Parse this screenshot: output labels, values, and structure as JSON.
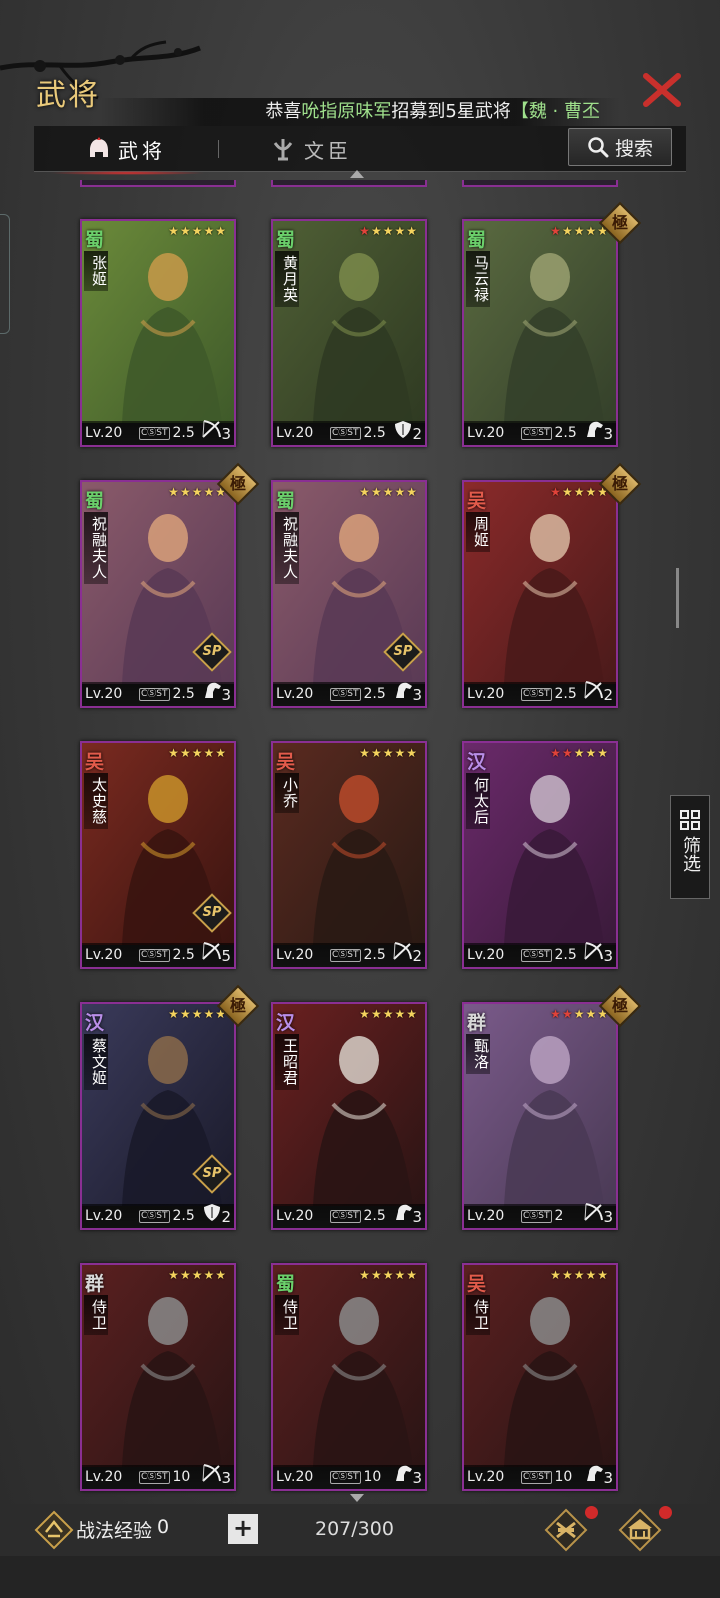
{
  "header": {
    "title": "武将",
    "notice": {
      "prefix": "恭喜",
      "player": "吮指原味军",
      "middle": "招募到5星武将",
      "bracket": "【",
      "general": "魏 · 曹丕"
    }
  },
  "tabs": [
    {
      "label": "武将",
      "active": true,
      "icon": "helmet-icon"
    },
    {
      "label": "文臣",
      "active": false,
      "icon": "scholar-icon"
    }
  ],
  "search": {
    "label": "搜索",
    "icon": "search-icon"
  },
  "filter": {
    "label": "筛选",
    "icon": "grid-icon"
  },
  "cards": [
    {
      "faction": "蜀",
      "name": "张姬",
      "stars": 5,
      "red_stars": 0,
      "ji": false,
      "sp": false,
      "level": "Lv.20",
      "cost": "2.5",
      "troop": "bow",
      "troop_num": "3"
    },
    {
      "faction": "蜀",
      "name": "黄月英",
      "stars": 5,
      "red_stars": 1,
      "ji": false,
      "sp": false,
      "level": "Lv.20",
      "cost": "2.5",
      "troop": "shield",
      "troop_num": "2"
    },
    {
      "faction": "蜀",
      "name": "马云禄",
      "stars": 5,
      "red_stars": 1,
      "ji": true,
      "sp": false,
      "level": "Lv.20",
      "cost": "2.5",
      "troop": "horse",
      "troop_num": "3"
    },
    {
      "faction": "蜀",
      "name": "祝融夫人",
      "stars": 5,
      "red_stars": 0,
      "ji": true,
      "sp": true,
      "level": "Lv.20",
      "cost": "2.5",
      "troop": "horse",
      "troop_num": "3"
    },
    {
      "faction": "蜀",
      "name": "祝融夫人",
      "stars": 5,
      "red_stars": 0,
      "ji": false,
      "sp": true,
      "level": "Lv.20",
      "cost": "2.5",
      "troop": "horse",
      "troop_num": "3"
    },
    {
      "faction": "吴",
      "name": "周姬",
      "stars": 5,
      "red_stars": 1,
      "ji": true,
      "sp": false,
      "level": "Lv.20",
      "cost": "2.5",
      "troop": "bow",
      "troop_num": "2"
    },
    {
      "faction": "吴",
      "name": "太史慈",
      "stars": 5,
      "red_stars": 0,
      "ji": false,
      "sp": true,
      "level": "Lv.20",
      "cost": "2.5",
      "troop": "bow",
      "troop_num": "5"
    },
    {
      "faction": "吴",
      "name": "小乔",
      "stars": 5,
      "red_stars": 0,
      "ji": false,
      "sp": false,
      "level": "Lv.20",
      "cost": "2.5",
      "troop": "bow",
      "troop_num": "2"
    },
    {
      "faction": "汉",
      "name": "何太后",
      "stars": 5,
      "red_stars": 2,
      "ji": false,
      "sp": false,
      "level": "Lv.20",
      "cost": "2.5",
      "troop": "bow",
      "troop_num": "3"
    },
    {
      "faction": "汉",
      "name": "蔡文姬",
      "stars": 5,
      "red_stars": 0,
      "ji": true,
      "sp": true,
      "level": "Lv.20",
      "cost": "2.5",
      "troop": "shield",
      "troop_num": "2"
    },
    {
      "faction": "汉",
      "name": "王昭君",
      "stars": 5,
      "red_stars": 0,
      "ji": false,
      "sp": false,
      "level": "Lv.20",
      "cost": "2.5",
      "troop": "horse",
      "troop_num": "3"
    },
    {
      "faction": "群",
      "name": "甄洛",
      "stars": 5,
      "red_stars": 2,
      "ji": true,
      "sp": false,
      "level": "Lv.20",
      "cost": "2",
      "troop": "bow",
      "troop_num": "3"
    },
    {
      "faction": "群",
      "name": "侍卫",
      "stars": 5,
      "red_stars": 0,
      "ji": false,
      "sp": false,
      "level": "Lv.20",
      "cost": "10",
      "troop": "bow",
      "troop_num": "3"
    },
    {
      "faction": "蜀",
      "name": "侍卫",
      "stars": 5,
      "red_stars": 0,
      "ji": false,
      "sp": false,
      "level": "Lv.20",
      "cost": "10",
      "troop": "horse",
      "troop_num": "3"
    },
    {
      "faction": "吴",
      "name": "侍卫",
      "stars": 5,
      "red_stars": 0,
      "ji": false,
      "sp": false,
      "level": "Lv.20",
      "cost": "10",
      "troop": "horse",
      "troop_num": "3"
    }
  ],
  "cost_label": "CⓈST",
  "ji_label": "極",
  "sp_label": "SP",
  "footer": {
    "exp_label": "战法经验",
    "exp_value": "0",
    "plus": "+",
    "count": "207/300"
  },
  "colors": {
    "card_border": "#8a2f93",
    "shu": "#6bd06b",
    "wu": "#e25b4b",
    "han": "#b98ee8",
    "qun": "#d8d8d8",
    "accent_red": "#e03030",
    "star": "#f4d35e"
  }
}
